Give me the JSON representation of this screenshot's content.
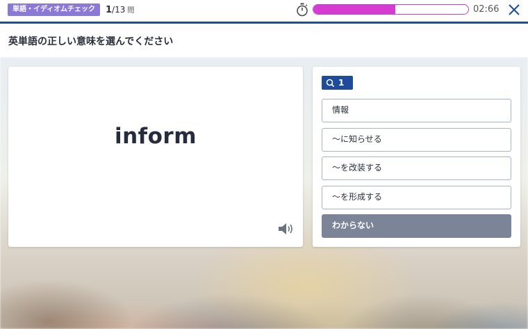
{
  "header": {
    "category": "単語・イディオムチェック",
    "progress_current": "1",
    "progress_total": "/13",
    "progress_unit": "問",
    "timer_text": "02:66",
    "timer_progress": 0.53,
    "timer_fill_color": "#d53bd1",
    "accent_color": "#1e4c9a"
  },
  "instruction": "英単語の正しい意味を選んでください",
  "word_card": {
    "word": "inform",
    "speaker_icon": "speaker-icon"
  },
  "answer_panel": {
    "question_number": "1",
    "question_icon": "search-icon",
    "options": [
      "情報",
      "～に知らせる",
      "～を改装する",
      "～を形成する"
    ],
    "dont_know": "わからない"
  }
}
